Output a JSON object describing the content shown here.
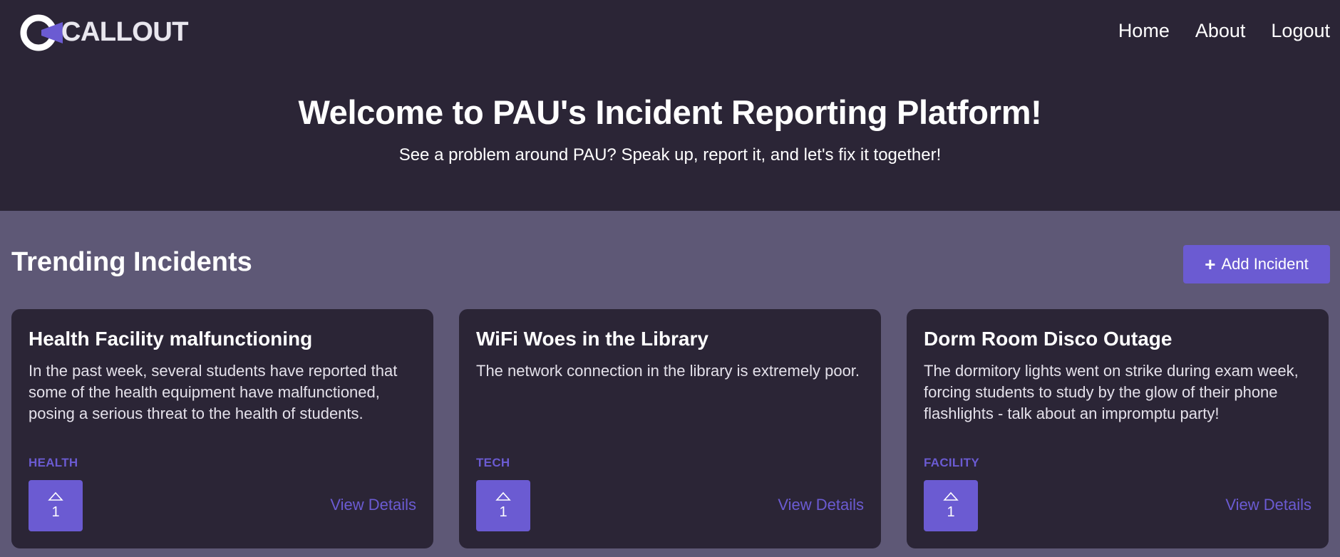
{
  "header": {
    "logo_text": "CALLOUT",
    "nav": [
      "Home",
      "About",
      "Logout"
    ]
  },
  "hero": {
    "title": "Welcome to PAU's Incident Reporting Platform!",
    "subtitle": "See a problem around PAU? Speak up, report it, and let's fix it together!"
  },
  "trending": {
    "title": "Trending Incidents",
    "add_button": "Add Incident",
    "view_label": "View Details",
    "cards": [
      {
        "title": "Health Facility malfunctioning",
        "description": "In the past week, several students have reported that some of the health equipment have malfunctioned, posing a serious threat to the health of students.",
        "tag": "HEALTH",
        "votes": "1"
      },
      {
        "title": "WiFi Woes in the Library",
        "description": "The network connection in the library is extremely poor.",
        "tag": "TECH",
        "votes": "1"
      },
      {
        "title": "Dorm Room Disco Outage",
        "description": "The dormitory lights went on strike during exam week, forcing students to study by the glow of their phone flashlights - talk about an impromptu party!",
        "tag": "FACILITY",
        "votes": "1"
      }
    ]
  },
  "colors": {
    "header_bg": "#2b2536",
    "page_bg": "#5e5876",
    "accent": "#6b5bd2"
  },
  "icons": [
    "logo-icon",
    "plus-icon",
    "upvote-icon"
  ]
}
